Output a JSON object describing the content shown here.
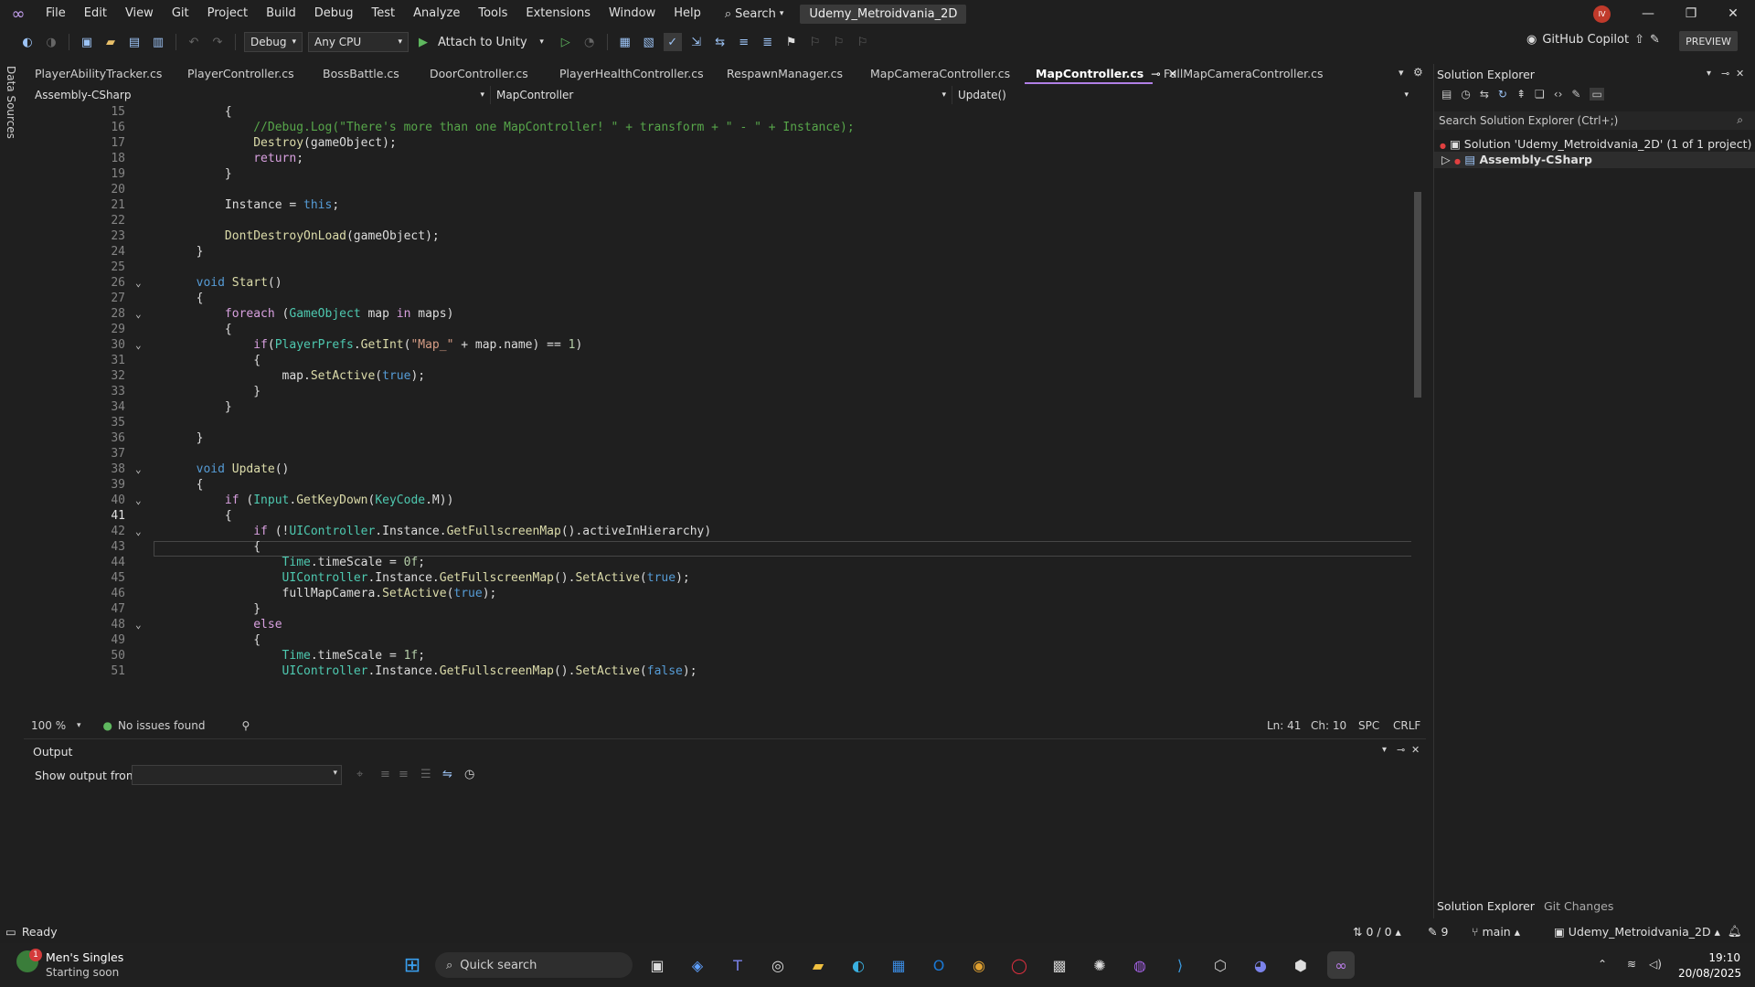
{
  "menubar": {
    "items": [
      "File",
      "Edit",
      "View",
      "Git",
      "Project",
      "Build",
      "Debug",
      "Test",
      "Analyze",
      "Tools",
      "Extensions",
      "Window",
      "Help"
    ],
    "search_label": "Search",
    "solution_name": "Udemy_Metroidvania_2D",
    "avatar_initials": "IV"
  },
  "toolbar": {
    "config": "Debug",
    "platform": "Any CPU",
    "attach_label": "Attach to Unity",
    "copilot_label": "GitHub Copilot",
    "preview_label": "PREVIEW"
  },
  "left_strip_label": "Data Sources",
  "tabs": [
    {
      "label": "PlayerAbilityTracker.cs"
    },
    {
      "label": "PlayerController.cs"
    },
    {
      "label": "BossBattle.cs"
    },
    {
      "label": "DoorController.cs"
    },
    {
      "label": "PlayerHealthController.cs"
    },
    {
      "label": "RespawnManager.cs"
    },
    {
      "label": "MapCameraController.cs"
    },
    {
      "label": "MapController.cs",
      "active": true
    },
    {
      "label": "FullMapCameraController.cs"
    }
  ],
  "navbar": {
    "project": "Assembly-CSharp",
    "class": "MapController",
    "member": "Update()"
  },
  "code_lines": [
    {
      "n": "15",
      "t": "            {"
    },
    {
      "n": "16",
      "t": "                //Debug.Log(\"There's more than one MapController! \" + transform + \" - \" + Instance);"
    },
    {
      "n": "17",
      "t": "                Destroy(gameObject);"
    },
    {
      "n": "18",
      "t": "                return;"
    },
    {
      "n": "19",
      "t": "            }"
    },
    {
      "n": "20",
      "t": ""
    },
    {
      "n": "21",
      "t": "            Instance = this;"
    },
    {
      "n": "22",
      "t": ""
    },
    {
      "n": "23",
      "t": "            DontDestroyOnLoad(gameObject);"
    },
    {
      "n": "24",
      "t": "        }"
    },
    {
      "n": "25",
      "t": ""
    },
    {
      "n": "26",
      "t": "        void Start()"
    },
    {
      "n": "27",
      "t": "        {"
    },
    {
      "n": "28",
      "t": "            foreach (GameObject map in maps)"
    },
    {
      "n": "29",
      "t": "            {"
    },
    {
      "n": "30",
      "t": "                if(PlayerPrefs.GetInt(\"Map_\" + map.name) == 1)"
    },
    {
      "n": "31",
      "t": "                {"
    },
    {
      "n": "32",
      "t": "                    map.SetActive(true);"
    },
    {
      "n": "33",
      "t": "                }"
    },
    {
      "n": "34",
      "t": "            }"
    },
    {
      "n": "35",
      "t": ""
    },
    {
      "n": "36",
      "t": "        }"
    },
    {
      "n": "37",
      "t": ""
    },
    {
      "n": "38",
      "t": "        void Update()"
    },
    {
      "n": "39",
      "t": "        {"
    },
    {
      "n": "40",
      "t": "            if (Input.GetKeyDown(KeyCode.M))"
    },
    {
      "n": "41",
      "t": "            {"
    },
    {
      "n": "42",
      "t": "                if (!UIController.Instance.GetFullscreenMap().activeInHierarchy)"
    },
    {
      "n": "43",
      "t": "                {"
    },
    {
      "n": "44",
      "t": "                    Time.timeScale = 0f;"
    },
    {
      "n": "45",
      "t": "                    UIController.Instance.GetFullscreenMap().SetActive(true);"
    },
    {
      "n": "46",
      "t": "                    fullMapCamera.SetActive(true);"
    },
    {
      "n": "47",
      "t": "                }"
    },
    {
      "n": "48",
      "t": "                else"
    },
    {
      "n": "49",
      "t": "                {"
    },
    {
      "n": "50",
      "t": "                    Time.timeScale = 1f;"
    },
    {
      "n": "51",
      "t": "                    UIController.Instance.GetFullscreenMap().SetActive(false);"
    }
  ],
  "editor_status": {
    "zoom": "100 %",
    "issues": "No issues found",
    "ln": "Ln: 41",
    "ch": "Ch: 10",
    "spc": "SPC",
    "crlf": "CRLF"
  },
  "output": {
    "title": "Output",
    "show_from": "Show output from:"
  },
  "solution_explorer": {
    "title": "Solution Explorer",
    "search_placeholder": "Search Solution Explorer (Ctrl+;)",
    "solution": "Solution 'Udemy_Metroidvania_2D' (1 of 1 project)",
    "project": "Assembly-CSharp",
    "tab1": "Solution Explorer",
    "tab2": "Git Changes"
  },
  "statusbar": {
    "ready": "Ready",
    "changes": "0 / 0",
    "edits": "9",
    "branch": "main",
    "repo": "Udemy_Metroidvania_2D"
  },
  "taskbar": {
    "notif_title": "Men's Singles",
    "notif_sub": "Starting soon",
    "notif_count": "1",
    "search": "Quick search",
    "time": "19:10",
    "date": "20/08/2025"
  }
}
